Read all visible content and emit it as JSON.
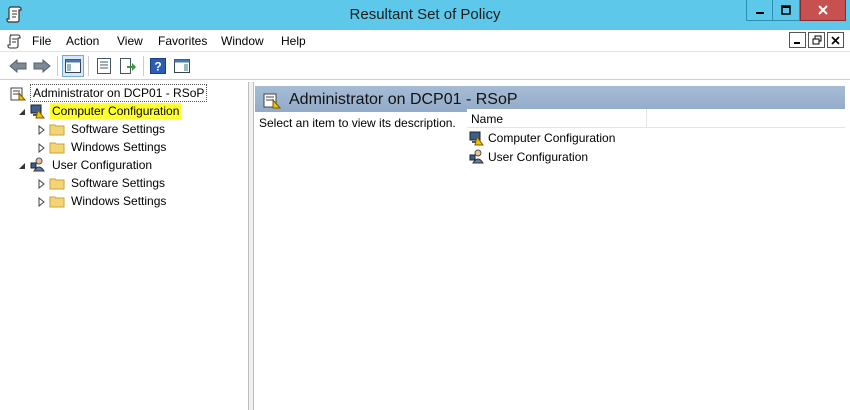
{
  "window": {
    "title": "Resultant Set of Policy"
  },
  "menu": {
    "items": [
      "File",
      "Action",
      "View",
      "Favorites",
      "Window",
      "Help"
    ]
  },
  "toolbar": {
    "icons": [
      "back-arrow-icon",
      "forward-arrow-icon",
      "show-hide-console-tree-icon",
      "properties-icon",
      "export-list-icon",
      "help-icon",
      "show-hide-action-pane-icon"
    ]
  },
  "tree": {
    "root": "Administrator on DCP01 - RSoP",
    "computer": {
      "label": "Computer Configuration",
      "children": [
        "Software Settings",
        "Windows Settings"
      ]
    },
    "user": {
      "label": "User Configuration",
      "children": [
        "Software Settings",
        "Windows Settings"
      ]
    }
  },
  "details": {
    "header": "Administrator on DCP01 - RSoP",
    "description": "Select an item to view its description.",
    "column_name": "Name",
    "rows": [
      "Computer Configuration",
      "User Configuration"
    ]
  },
  "colors": {
    "titlebar": "#5ec8ea",
    "close_button": "#c75050",
    "highlight": "#ffff2b",
    "pane_header": "#a6bcd5"
  }
}
